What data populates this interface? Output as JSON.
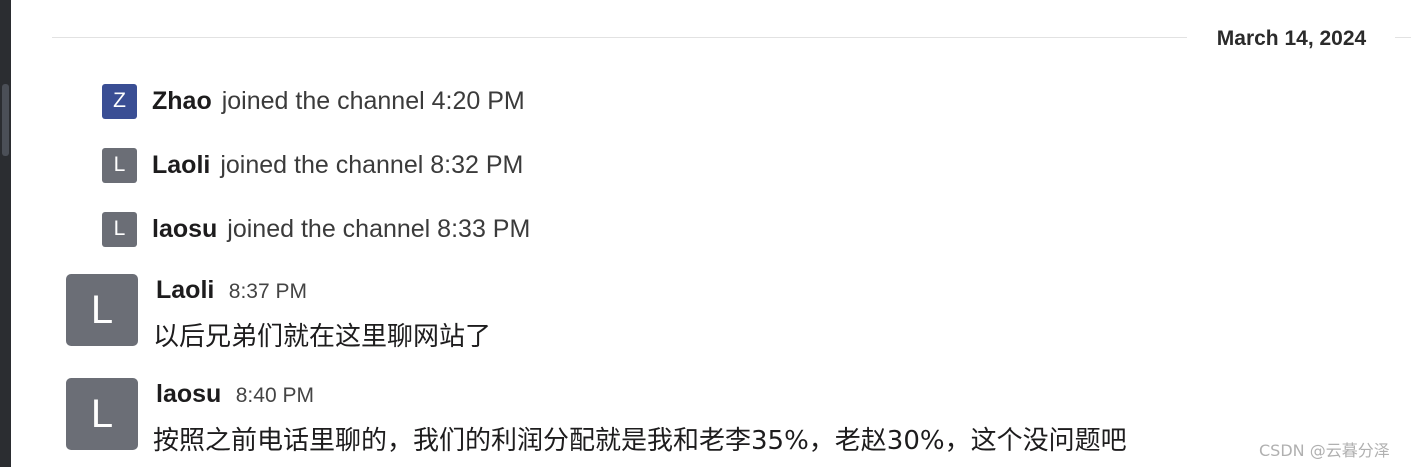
{
  "date_divider": "March 14, 2024",
  "system_events": [
    {
      "avatar_letter": "Z",
      "avatar_color": "#3a4e94",
      "name": "Zhao",
      "text": "joined the channel 4:20 PM"
    },
    {
      "avatar_letter": "L",
      "avatar_color": "#6b6e76",
      "name": "Laoli",
      "text": "joined the channel 8:32 PM"
    },
    {
      "avatar_letter": "L",
      "avatar_color": "#6b6e76",
      "name": "laosu",
      "text": "joined the channel 8:33 PM"
    }
  ],
  "messages": [
    {
      "avatar_letter": "L",
      "author": "Laoli",
      "time": "8:37 PM",
      "text": "以后兄弟们就在这里聊网站了"
    },
    {
      "avatar_letter": "L",
      "author": "laosu",
      "time": "8:40 PM",
      "text": "按照之前电话里聊的，我们的利润分配就是我和老李35%，老赵30%，这个没问题吧"
    }
  ],
  "watermark": "CSDN @云暮分泽"
}
